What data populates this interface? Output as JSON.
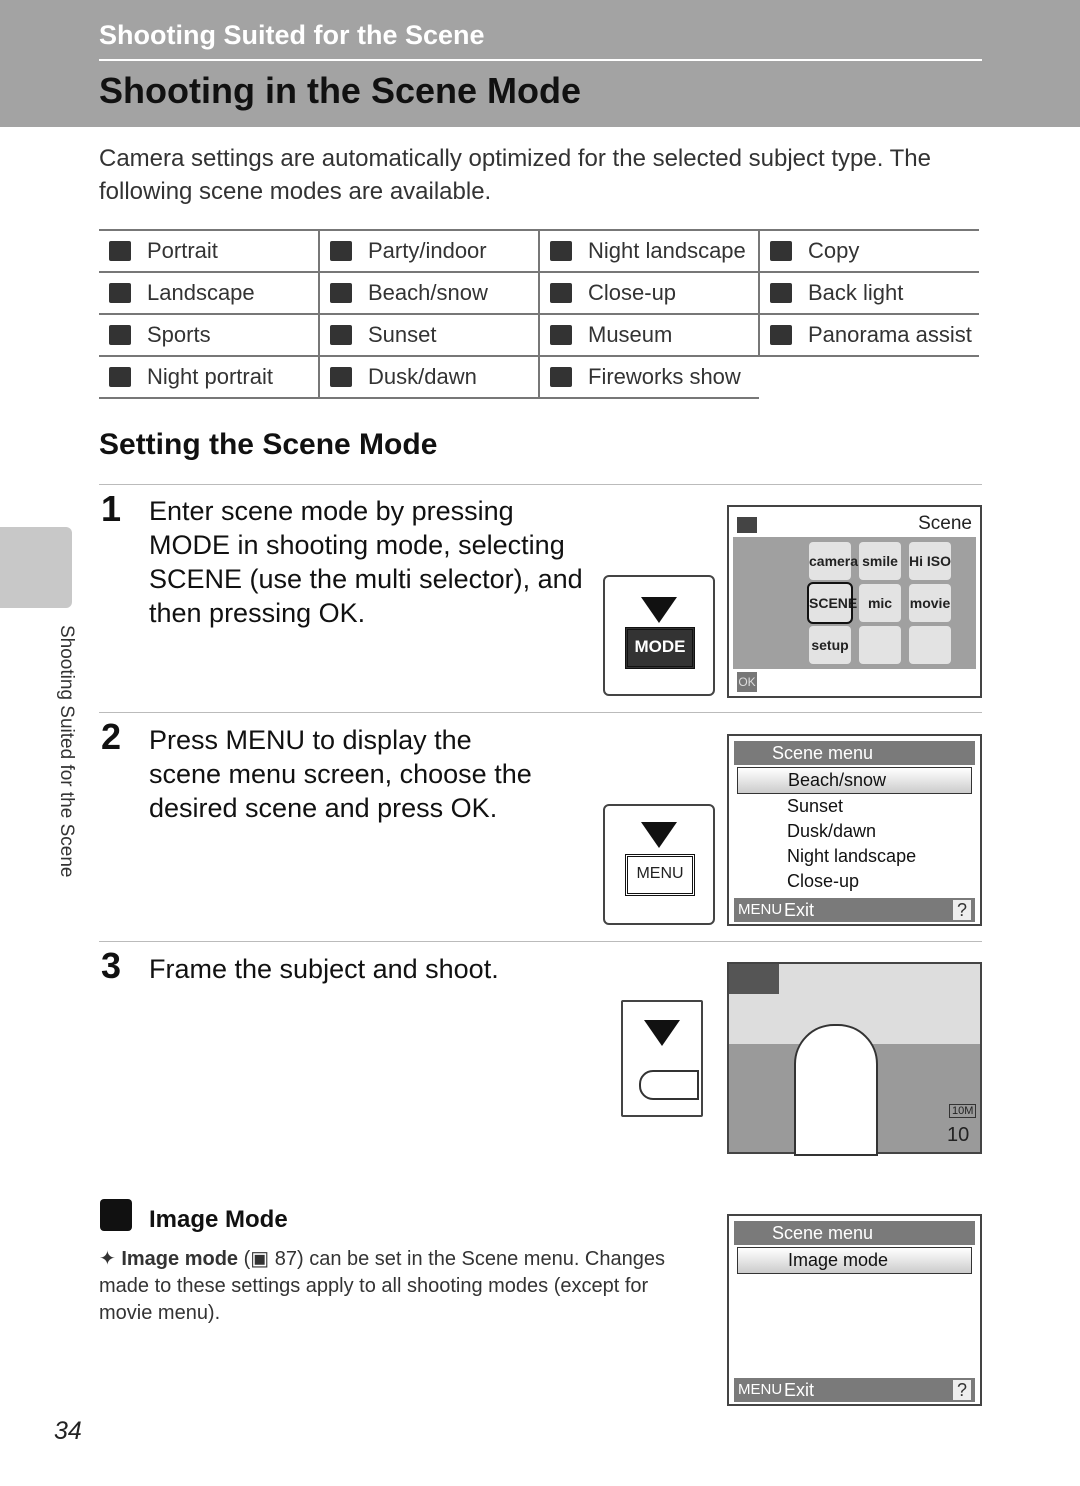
{
  "header": {
    "section": "Shooting Suited for the Scene",
    "title": "Shooting in the Scene Mode"
  },
  "intro": "Camera settings are automatically optimized for the selected subject type. The following scene modes are available.",
  "scene_table": [
    [
      "Portrait",
      "Party/indoor",
      "Night landscape",
      "Copy"
    ],
    [
      "Landscape",
      "Beach/snow",
      "Close-up",
      "Back light"
    ],
    [
      "Sports",
      "Sunset",
      "Museum",
      "Panorama assist"
    ],
    [
      "Night portrait",
      "Dusk/dawn",
      "Fireworks show",
      ""
    ]
  ],
  "setting_title": "Setting the Scene Mode",
  "steps": [
    {
      "num": "1",
      "text": "Enter scene mode by pressing MODE in shooting mode, selecting SCENE (use the multi selector), and then pressing OK.",
      "button": "MODE",
      "screen": {
        "title": "Scene",
        "grid": [
          "camera",
          "smile",
          "Hi ISO",
          "SCENE",
          "mic",
          "movie",
          "setup",
          "",
          ""
        ],
        "ok": "OK"
      }
    },
    {
      "num": "2",
      "text": "Press MENU to display the scene menu screen, choose the desired scene and press OK.",
      "button": "MENU",
      "screen": {
        "title": "Scene menu",
        "items": [
          "Beach/snow",
          "Sunset",
          "Dusk/dawn",
          "Night landscape",
          "Close-up"
        ],
        "exit": "Exit",
        "menu": "MENU",
        "help": "?"
      }
    },
    {
      "num": "3",
      "text": "Frame the subject and shoot.",
      "screen": {
        "counter": "10",
        "size": "10M"
      }
    }
  ],
  "image_mode": {
    "title": "Image Mode",
    "bold": "Image mode",
    "ref": "87",
    "text": " can be set in the Scene menu. Changes made to these settings apply to all shooting modes (except for movie menu).",
    "screen": {
      "title": "Scene menu",
      "item": "Image mode",
      "exit": "Exit",
      "menu": "MENU",
      "help": "?"
    }
  },
  "side_tab": "Shooting Suited for the Scene",
  "page_number": "34"
}
